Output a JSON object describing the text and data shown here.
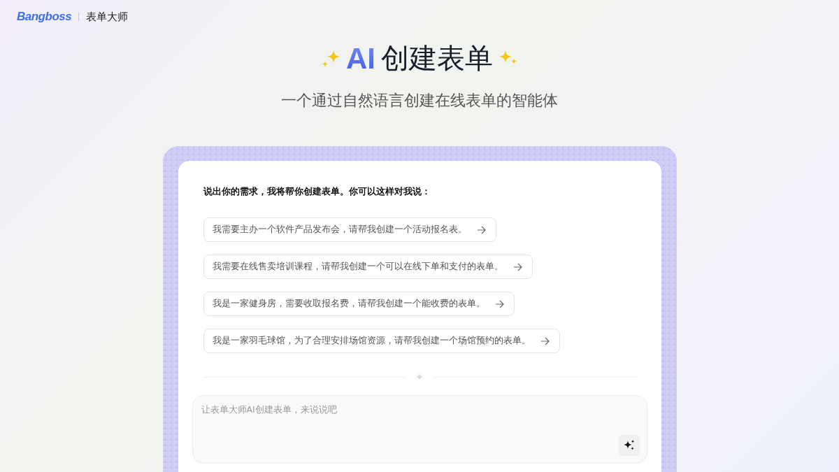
{
  "header": {
    "logo": "Bangboss",
    "product": "表单大师"
  },
  "hero": {
    "highlight": "AI",
    "title": "创建表单",
    "subtitle": "一个通过自然语言创建在线表单的智能体"
  },
  "prompt_card": {
    "heading": "说出你的需求，我将帮你创建表单。你可以这样对我说：",
    "suggestions": [
      "我需要主办一个软件产品发布会，请帮我创建一个活动报名表。",
      "我需要在线售卖培训课程，请帮我创建一个可以在线下单和支付的表单。",
      "我是一家健身房，需要收取报名费，请帮我创建一个能收费的表单。",
      "我是一家羽毛球馆，为了合理安排场馆资源，请帮我创建一个场馆预约的表单。"
    ],
    "input": {
      "placeholder": "让表单大师AI创建表单，来说说吧"
    }
  }
}
